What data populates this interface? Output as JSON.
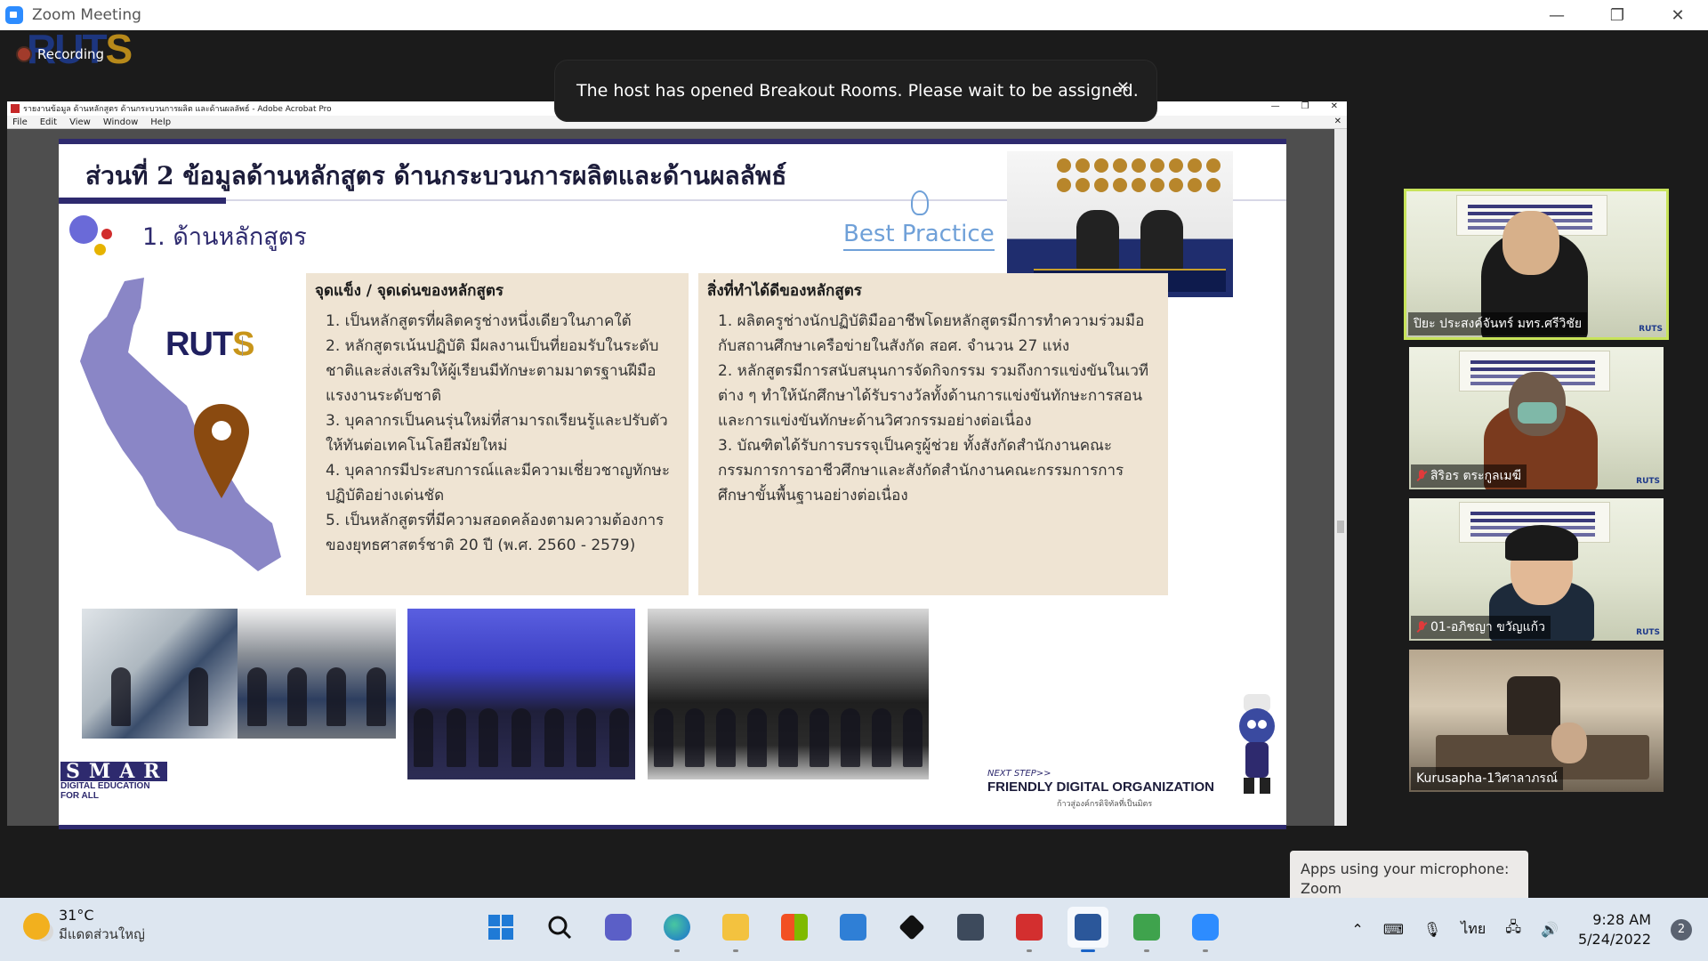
{
  "window": {
    "title": "Zoom Meeting",
    "controls": [
      "—",
      "❐",
      "✕"
    ]
  },
  "recording": {
    "label": "Recording"
  },
  "watermark": {
    "brand_a": "RUT",
    "brand_b": "S"
  },
  "banner": {
    "message": "The host has opened Breakout Rooms. Please wait to be assigned.",
    "close": "✕"
  },
  "acrobat": {
    "title": "รายงานข้อมูล ด้านหลักสูตร ด้านกระบวนการผลิต และด้านผลลัพธ์ - Adobe Acrobat Pro",
    "controls": [
      "—",
      "❐",
      "✕"
    ],
    "menu": [
      "File",
      "Edit",
      "View",
      "Window",
      "Help"
    ],
    "doc_close": "✕"
  },
  "slide": {
    "title": "ส่วนที่ 2 ข้อมูลด้านหลักสูตร ด้านกระบวนการผลิตและด้านผลลัพธ์",
    "section": "1. ด้านหลักสูตร",
    "best_practice": "Best Practice",
    "logo_a": "RUT",
    "logo_b": "S",
    "panel1": {
      "heading": "จุดแข็ง / จุดเด่นของหลักสูตร",
      "items": [
        "1. เป็นหลักสูตรที่ผลิตครูช่างหนึ่งเดียวในภาคใต้",
        "2. หลักสูตรเน้นปฏิบัติ มีผลงานเป็นที่ยอมรับในระดับชาติและส่งเสริมให้ผู้เรียนมีทักษะตามมาตรฐานฝีมือแรงงานระดับชาติ",
        "3. บุคลากรเป็นคนรุ่นใหม่ที่สามารถเรียนรู้และปรับตัวให้ทันต่อเทคโนโลยีสมัยใหม่",
        "4. บุคลากรมีประสบการณ์และมีความเชี่ยวชาญทักษะปฏิบัติอย่างเด่นชัด",
        "5. เป็นหลักสูตรที่มีความสอดคล้องตามความต้องการของยุทธศาสตร์ชาติ 20 ปี (พ.ศ. 2560 - 2579)"
      ]
    },
    "panel2": {
      "heading": "สิ่งที่ทำได้ดีของหลักสูตร",
      "items": [
        "1. ผลิตครูช่างนักปฏิบัติมืออาชีพโดยหลักสูตรมีการทำความร่วมมือกับสถานศึกษาเครือข่ายในสังกัด สอศ. จำนวน 27 แห่ง",
        "2. หลักสูตรมีการสนับสนุนการจัดกิจกรรม รวมถึงการแข่งขันในเวทีต่าง ๆ ทำให้นักศึกษาได้รับรางวัลทั้งด้านการแข่งขันทักษะการสอนและการแข่งขันทักษะด้านวิศวกรรมอย่างต่อเนื่อง",
        "3. บัณฑิตได้รับการบรรจุเป็นครูผู้ช่วย ทั้งสังกัดสำนักงานคณะกรรมการการอาชีวศึกษาและสังกัดสำนักงานคณะกรรมการการศึกษาขั้นพื้นฐานอย่างต่อเนื่อง"
      ]
    },
    "smart": {
      "word": "SMART",
      "tag": "DIGITAL EDUCATION FOR ALL"
    },
    "next_step": "NEXT STEP>>",
    "friendly": "FRIENDLY DIGITAL ORGANIZATION",
    "friendly_th": "ก้าวสู่องค์กรดิจิทัลที่เป็นมิตร"
  },
  "participants": [
    {
      "name": "ปิยะ ประสงค์จันทร์ มทร.ศรีวิชัย",
      "muted": false,
      "active_speaker": true
    },
    {
      "name": "สิริอร ตระกูลเมฆี",
      "muted": true,
      "active_speaker": false
    },
    {
      "name": "01-อภิชญา ขวัญแก้ว",
      "muted": true,
      "active_speaker": false
    },
    {
      "name": "Kurusapha-1วิศาลาภรณ์",
      "muted": false,
      "active_speaker": false
    }
  ],
  "toast": {
    "line1": "Apps using your microphone:",
    "line2": "Zoom"
  },
  "taskbar": {
    "weather_temp": "31°C",
    "weather_desc": "มีแดดส่วนใหญ่",
    "language": "ไทย",
    "time": "9:28 AM",
    "date": "5/24/2022",
    "notifications": "2"
  },
  "colors": {
    "zoom_blue": "#2d8cff",
    "slide_navy": "#2e2a6e",
    "panel_beige": "#efe4d3",
    "active_speaker": "#c7e35a"
  }
}
